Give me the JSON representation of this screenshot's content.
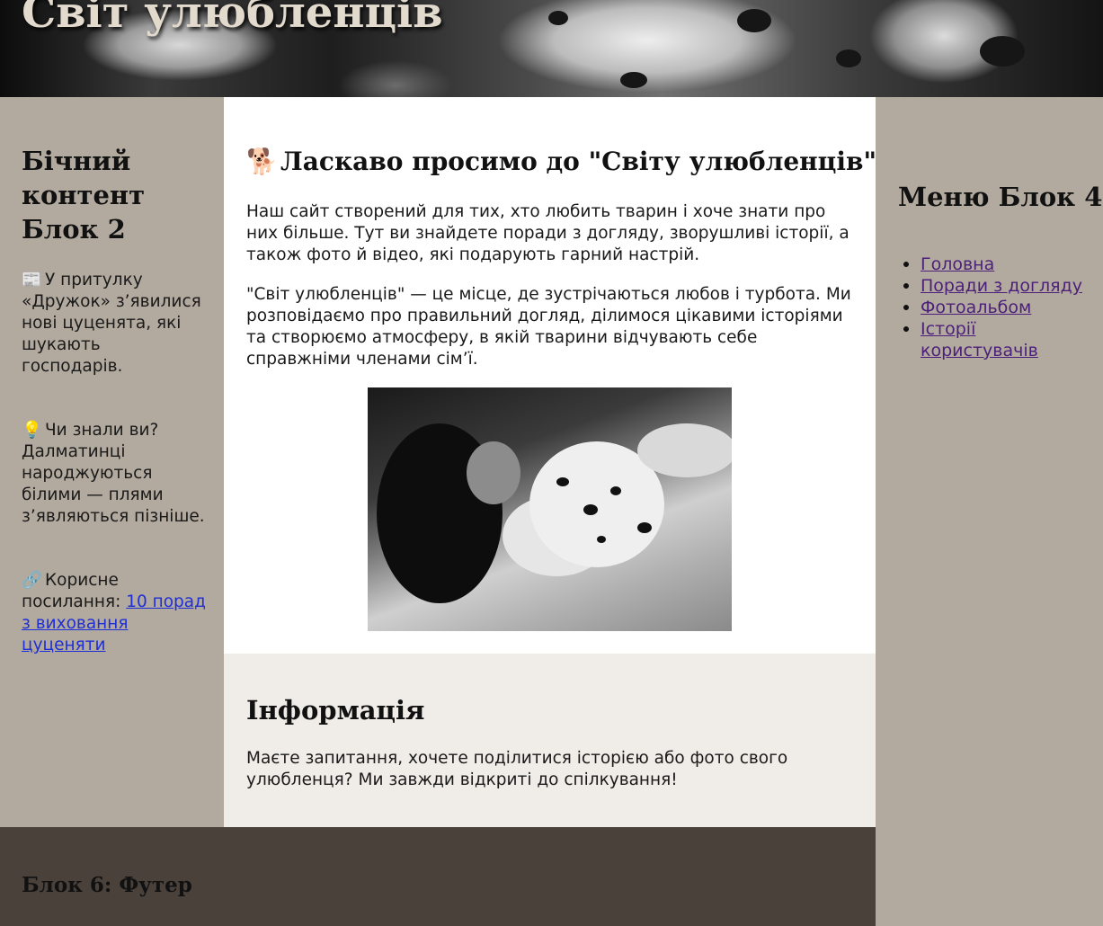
{
  "header": {
    "site_title": "Світ улюбленців"
  },
  "left_sidebar": {
    "heading": "Бічний контент Блок 2",
    "items": [
      {
        "icon": "📰",
        "text": "У притулку «Дружок» з’явилися нові цуценята, які шукають господарів."
      },
      {
        "icon": "💡",
        "text": "Чи знали ви? Далматинці народжуються білими — плями з’являються пізніше."
      },
      {
        "icon": "🔗",
        "text": "Корисне посилання:",
        "link": "10 порад з виховання цуценяти"
      }
    ]
  },
  "main": {
    "title_icon": "🐕",
    "title": "Ласкаво просимо до \"Світу улюбленців\"!",
    "paragraphs": [
      "Наш сайт створений для тих, хто любить тварин і хоче знати про них більше. Тут ви знайдете поради з догляду, зворушливі історії, а також фото й відео, які подарують гарний настрій.",
      "\"Світ улюбленців\" — це місце, де зустрічаються любов і турбота. Ми розповідаємо про правильний догляд, ділимося цікавими історіями та створюємо атмосферу, в якій тварини відчувають себе справжніми членами сім’ї."
    ]
  },
  "info": {
    "heading": "Інформація",
    "text": "Маєте запитання, хочете поділитися історією або фото свого улюбленця? Ми завжди відкриті до спілкування!"
  },
  "right_menu": {
    "heading": "Меню Блок 4",
    "items": [
      "Головна",
      "Поради з догляду",
      "Фотоальбом",
      "Історії користувачів"
    ]
  },
  "footer": {
    "heading": "Блок 6: Футер"
  },
  "colors": {
    "sidebar_bg": "#b3aa9f",
    "main_bg": "#ffffff",
    "info_bg": "#f0ece7",
    "footer_bg": "#4a413b",
    "link_blue": "#1f2fd6",
    "link_visited": "#4b1f7a"
  }
}
